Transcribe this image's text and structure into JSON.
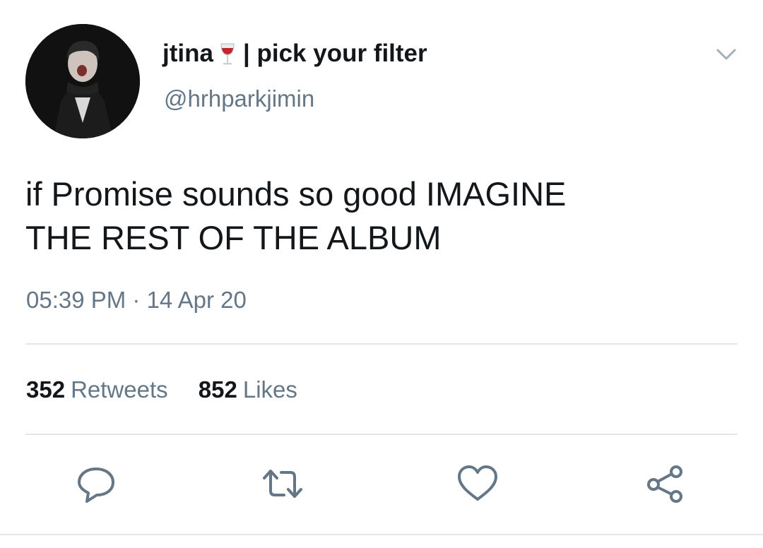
{
  "tweet": {
    "display_name": "jtina",
    "name_suffix": "| pick your filter",
    "name_emoji": "wine-glass-icon",
    "handle": "@hrhparkjimin",
    "text_line1": "if Promise sounds so good IMAGINE",
    "text_line2": "THE REST OF THE ALBUM",
    "timestamp": "05:39 PM · 14 Apr 20",
    "retweets_count": "352",
    "retweets_label": "Retweets",
    "likes_count": "852",
    "likes_label": "Likes"
  },
  "icons": {
    "menu": "chevron-down-icon",
    "actions": [
      "reply-icon",
      "retweet-icon",
      "like-icon",
      "share-icon"
    ]
  },
  "colors": {
    "text": "#14171a",
    "secondary": "#657786",
    "divider": "#e1e8ed",
    "icon": "#657786"
  }
}
